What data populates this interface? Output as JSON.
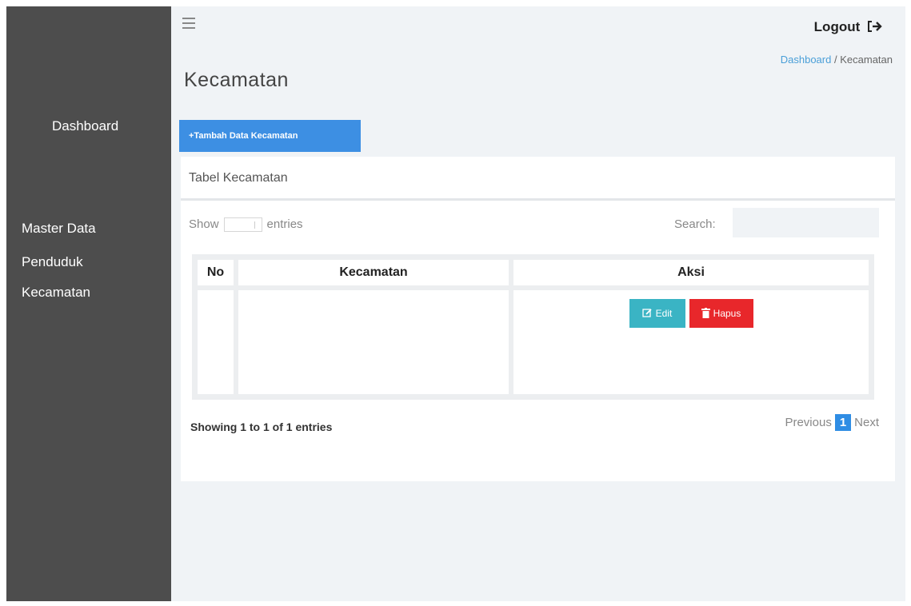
{
  "sidebar": {
    "items": [
      {
        "label": "Dashboard"
      },
      {
        "label": "Master Data"
      },
      {
        "label": "Penduduk"
      },
      {
        "label": "Kecamatan"
      }
    ]
  },
  "header": {
    "logout_label": "Logout",
    "logout_icon": "↦",
    "breadcrumb": {
      "link": "Dashboard",
      "separator": "/",
      "current": "Kecamatan"
    }
  },
  "page": {
    "title": "Kecamatan",
    "add_button_label": "+Tambah Data Kecamatan"
  },
  "card": {
    "title": "Tabel Kecamatan",
    "show_label": "Show",
    "entries_label": "entries",
    "search_label": "Search:",
    "table": {
      "headers": [
        "No",
        "Kecamatan",
        "Aksi"
      ],
      "rows": [
        {
          "no": "",
          "kecamatan": "",
          "edit_label": "Edit",
          "hapus_label": "Hapus"
        }
      ]
    },
    "info": "Showing 1 to 1 of 1 entries",
    "pagination": {
      "previous": "Previous",
      "current": "1",
      "next": "Next"
    }
  },
  "colors": {
    "sidebar": "#4d4d4d",
    "background": "#f0f3f6",
    "primary": "#3d8fe3",
    "edit": "#3ab4c4",
    "hapus": "#e8272b"
  },
  "icons": [
    "menu-icon",
    "logout-icon",
    "edit-icon",
    "trash-icon"
  ]
}
